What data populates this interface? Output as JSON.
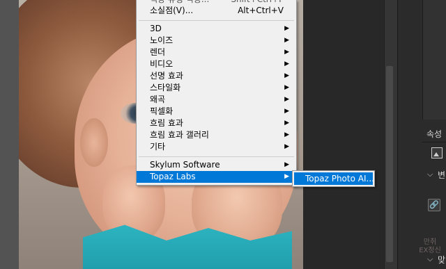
{
  "menu": {
    "partial_item": {
      "label": "색상 유형 적용...",
      "shortcut": "Shift+Ctrl+F"
    },
    "vanishing_point": {
      "label": "소실점(V)...",
      "shortcut": "Alt+Ctrl+V"
    },
    "filters": [
      "3D",
      "노이즈",
      "렌더",
      "비디오",
      "선명 효과",
      "스타일화",
      "왜곡",
      "픽셀화",
      "흐림 효과",
      "흐림 효과 갤러리",
      "기타"
    ],
    "plugins": [
      "Skylum Software",
      "Topaz Labs"
    ]
  },
  "submenu": {
    "item": "Topaz Photo AI..."
  },
  "panel": {
    "properties_label": "속성",
    "section1_label": "변",
    "section2_label": "맞",
    "link_glyph": "🔗"
  },
  "watermark": {
    "line1": "만취",
    "line2": "EX정신"
  },
  "colors": {
    "highlight": "#0078d7",
    "menu_bg": "#f0f0f0"
  }
}
